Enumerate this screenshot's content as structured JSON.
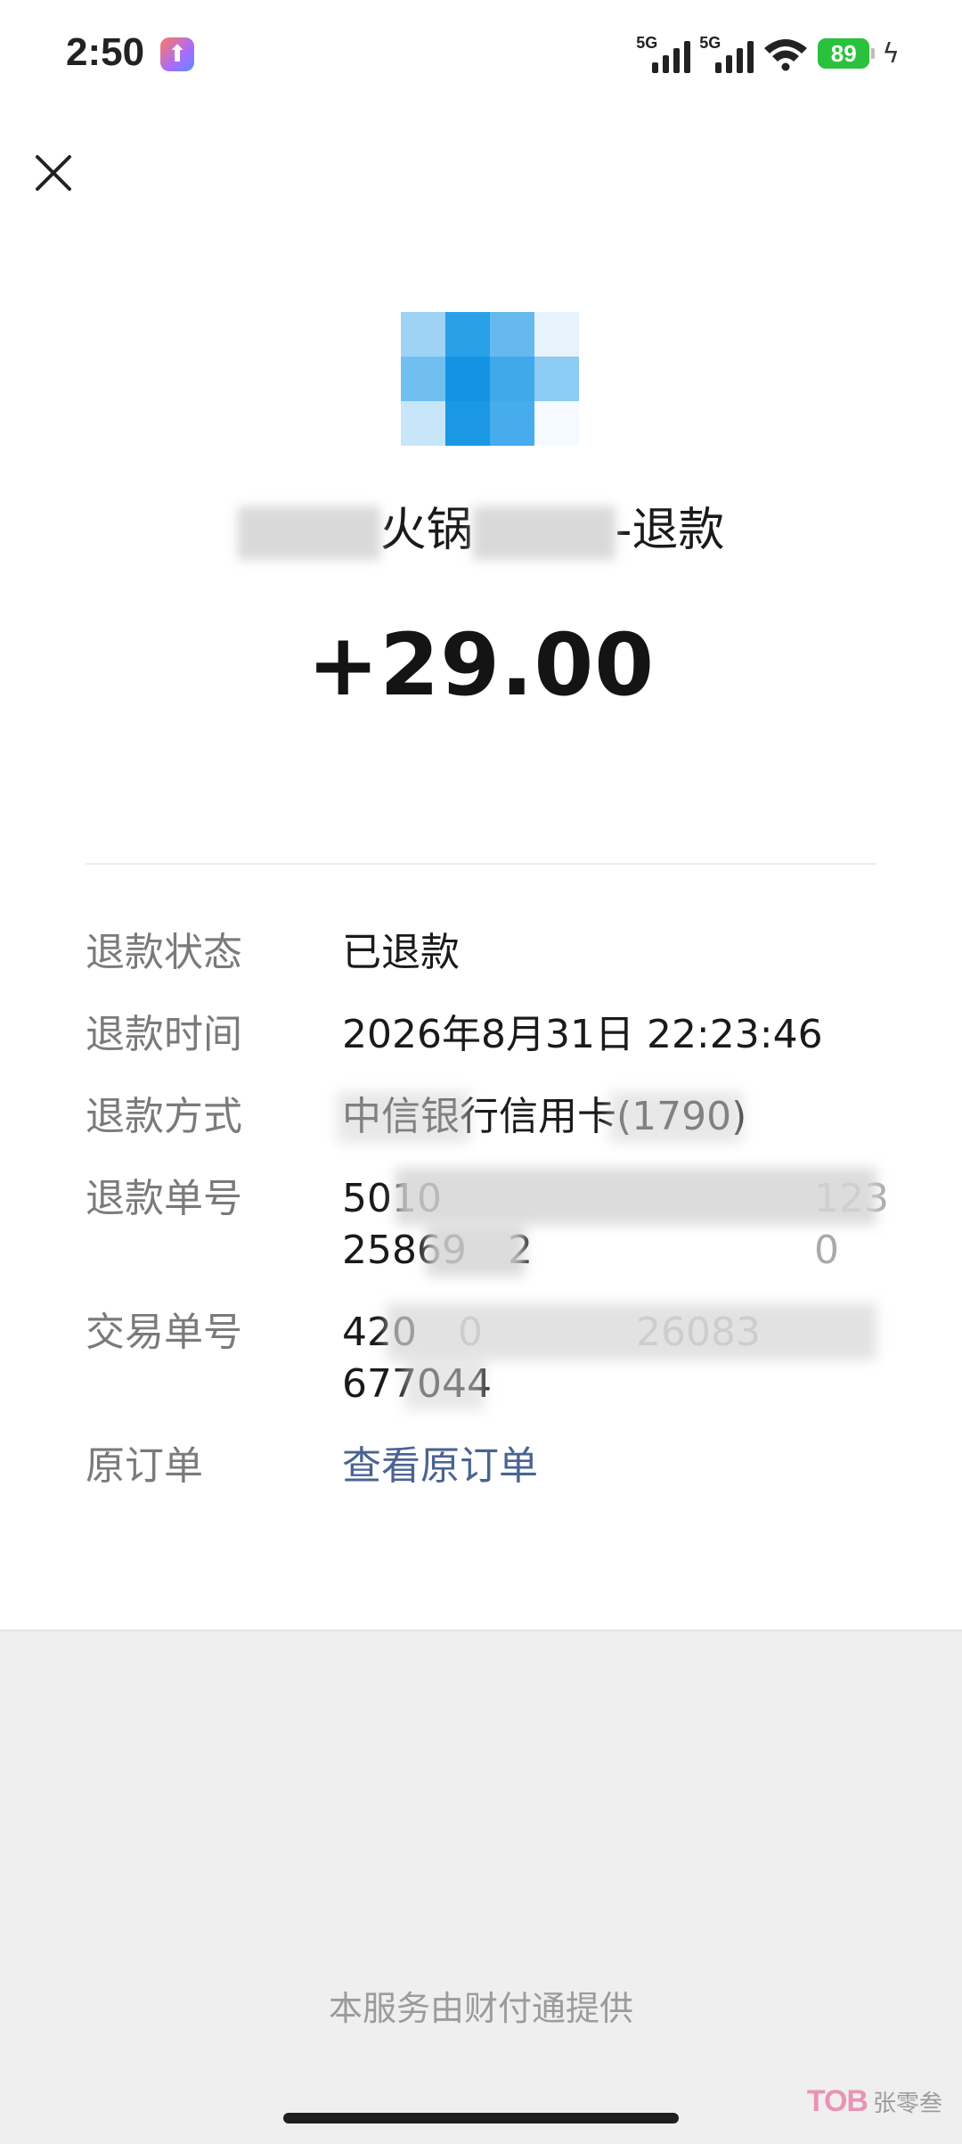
{
  "status_bar": {
    "time": "2:50",
    "network_label_1": "5G",
    "network_label_2": "5G",
    "battery_level": "89",
    "icons": [
      "app-badge-icon",
      "signal-icon",
      "signal-icon",
      "wifi-icon",
      "battery-icon",
      "charging-icon"
    ]
  },
  "header": {
    "close_icon": "close-icon"
  },
  "merchant": {
    "logo_icon": "merchant-logo-icon",
    "name_visible_part1": "火锅",
    "name_visible_part2": "-退款"
  },
  "amount": "+29.00",
  "details": {
    "refund_status_label": "退款状态",
    "refund_status_value": "已退款",
    "refund_time_label": "退款时间",
    "refund_time_value": "2026年8月31日 22:23:46",
    "refund_method_label": "退款方式",
    "refund_method_value": "中信银行信用卡(1790)",
    "refund_no_label": "退款单号",
    "refund_no_value_line1": "5010",
    "refund_no_value_line1_tail": "1230",
    "refund_no_value_line2": "25869",
    "refund_no_value_line2_tail": "2",
    "trade_no_label": "交易单号",
    "trade_no_value_line1": "420",
    "trade_no_value_line1_mid": "0",
    "trade_no_value_line1_tail": "26083",
    "trade_no_value_line2": "677044",
    "original_order_label": "原订单",
    "original_order_link": "查看原订单"
  },
  "footer": {
    "provider_text": "本服务由财付通提供",
    "watermark_logo": "TOB",
    "watermark_text": "张零叁"
  },
  "colors": {
    "link": "#4a6393",
    "label": "#7a7a7a",
    "battery": "#2ac13d",
    "footer_bg": "#efefef"
  }
}
